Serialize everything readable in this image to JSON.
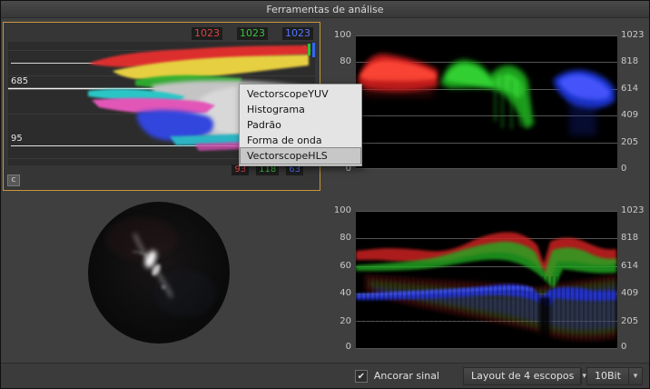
{
  "titlebar": {
    "title": "Ferramentas de análise"
  },
  "waveform_scope": {
    "max_values": {
      "red": "1023",
      "green": "1023",
      "blue": "1023"
    },
    "current_values": {
      "red": "93",
      "green": "118",
      "blue": "63"
    },
    "line_labels": {
      "upper": "685",
      "lower": "95"
    },
    "corner_button_label": "c"
  },
  "context_menu": {
    "items": [
      {
        "label": "VectorscopeYUV"
      },
      {
        "label": "Histograma"
      },
      {
        "label": "Padrão"
      },
      {
        "label": "Forma de onda"
      },
      {
        "label": "VectorscopeHLS"
      }
    ],
    "highlighted": "VectorscopeHLS"
  },
  "rgb_parade": {
    "left_ticks": [
      "100",
      "80",
      "60",
      "40",
      "20",
      "0"
    ],
    "right_ticks": [
      "1023",
      "818",
      "614",
      "409",
      "205",
      "0"
    ]
  },
  "rgb_overlay": {
    "left_ticks": [
      "100",
      "80",
      "60",
      "40",
      "20",
      "0"
    ],
    "right_ticks": [
      "1023",
      "818",
      "614",
      "409",
      "205",
      "0"
    ]
  },
  "statusbar": {
    "anchor_checkbox": {
      "label": "Ancorar sinal",
      "checked": true
    },
    "layout_dropdown": {
      "value": "Layout de 4 escopos"
    },
    "bit_depth_dropdown": {
      "value": "10Bit"
    }
  },
  "icons": {
    "dropdown_arrow": "▾",
    "checkbox_check": "✔"
  },
  "colors": {
    "selection_border": "#c9973b",
    "red": "#e03a3a",
    "green": "#3ab53a",
    "blue": "#4a6aff",
    "menu_bg": "#e4e4e4"
  }
}
